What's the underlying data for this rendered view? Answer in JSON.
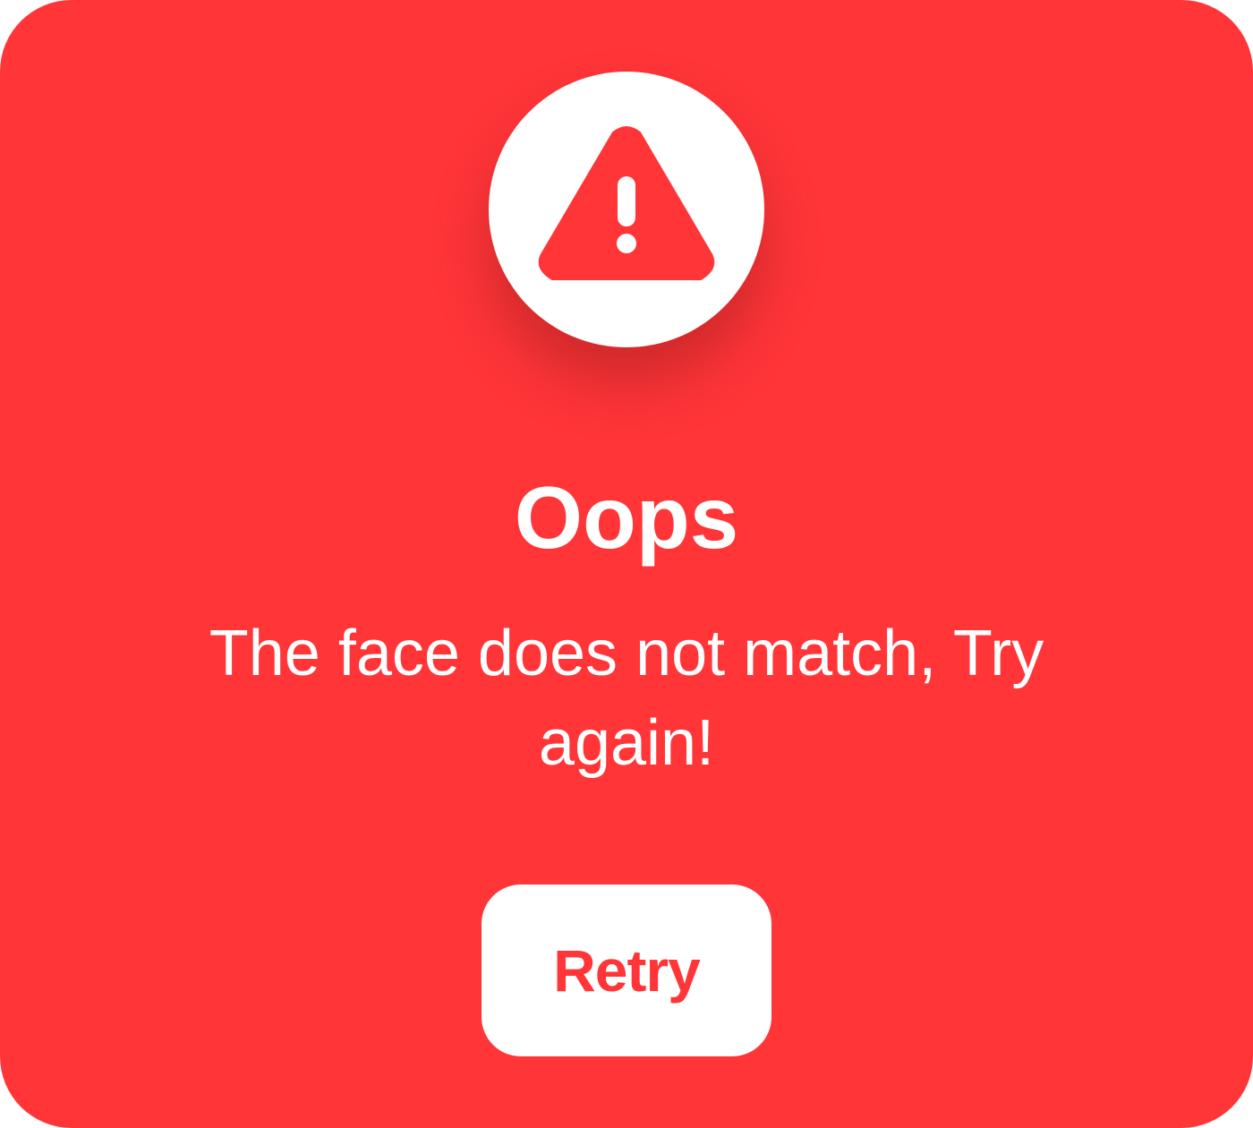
{
  "dialog": {
    "icon": "warning-triangle-icon",
    "title": "Oops",
    "message": "The face does not match, Try again!",
    "retry_label": "Retry"
  },
  "colors": {
    "background": "#ff3538",
    "surface": "#ffffff",
    "accent": "#ff3538"
  }
}
